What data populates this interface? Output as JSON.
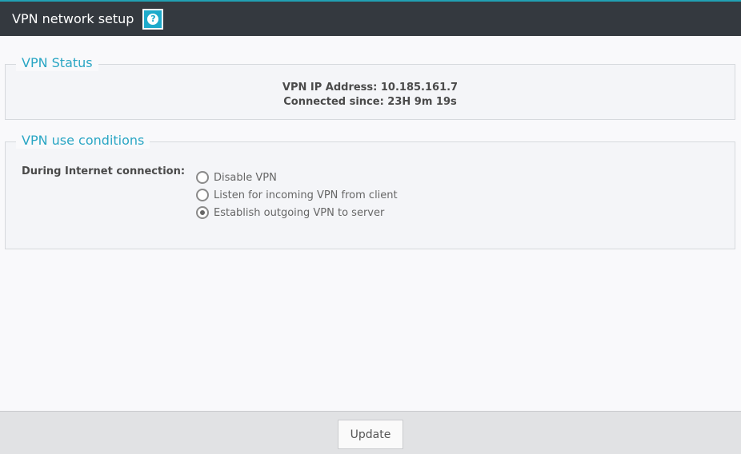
{
  "header": {
    "title": "VPN network setup",
    "help_glyph": "?",
    "help_icon": "question-icon"
  },
  "status": {
    "legend": "VPN Status",
    "ip_line": "VPN IP Address: 10.185.161.7",
    "connected_line": "Connected since: 23H 9m 19s"
  },
  "conditions": {
    "legend": "VPN use conditions",
    "label": "During Internet connection:",
    "options": [
      {
        "label": "Disable VPN",
        "selected": false
      },
      {
        "label": "Listen for incoming VPN from client",
        "selected": false
      },
      {
        "label": "Establish outgoing VPN to server",
        "selected": true
      }
    ]
  },
  "footer": {
    "update_label": "Update"
  },
  "colors": {
    "header_bg": "#34393f",
    "accent": "#2aa6c4",
    "help_bg": "#1eaacb",
    "footer_bg": "#e1e2e4"
  }
}
